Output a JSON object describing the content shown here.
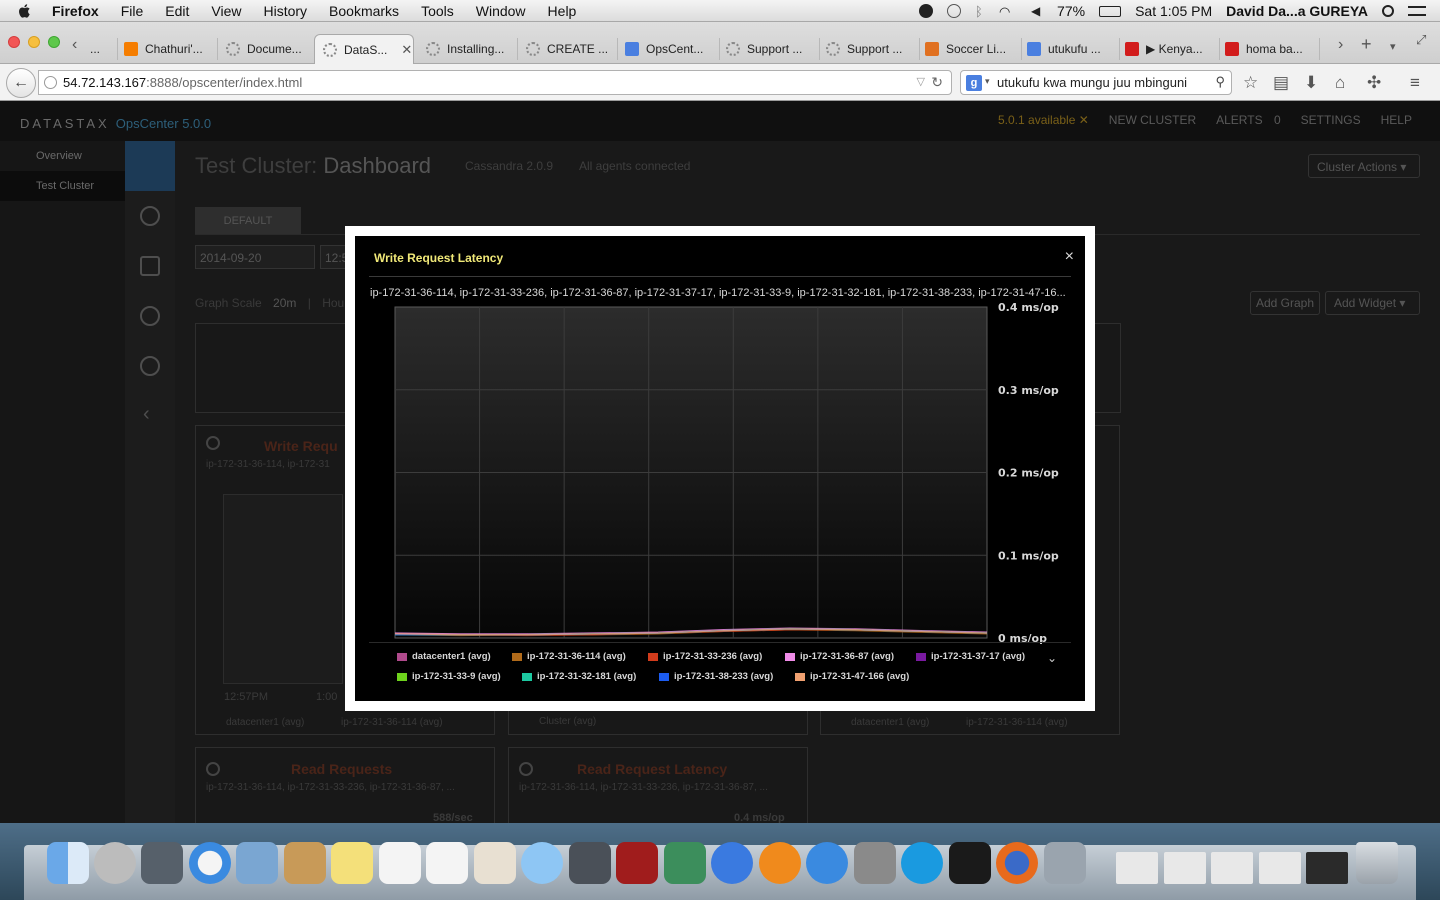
{
  "menubar": {
    "app": "Firefox",
    "items": [
      "File",
      "Edit",
      "View",
      "History",
      "Bookmarks",
      "Tools",
      "Window",
      "Help"
    ],
    "battery": "77%",
    "clock": "Sat 1:05 PM",
    "user": "David Da...a GUREYA"
  },
  "browser": {
    "tabs": [
      {
        "label": "...",
        "color": "#d0d0d0"
      },
      {
        "label": "Chathuri'...",
        "color": "#f57d00"
      },
      {
        "label": "Docume...",
        "color": "#888888"
      },
      {
        "label": "DataS...",
        "color": "#888888",
        "active": true
      },
      {
        "label": "Installing...",
        "color": "#888888"
      },
      {
        "label": "CREATE ...",
        "color": "#888888"
      },
      {
        "label": "OpsCent...",
        "color": "#4a7fe0"
      },
      {
        "label": "Support ...",
        "color": "#888888"
      },
      {
        "label": "Support ...",
        "color": "#888888"
      },
      {
        "label": "Soccer Li...",
        "color": "#e07020"
      },
      {
        "label": "utukufu ...",
        "color": "#4a7fe0"
      },
      {
        "label": "▶ Kenya...",
        "color": "#d21c1c"
      },
      {
        "label": "homa ba...",
        "color": "#d21c1c"
      }
    ],
    "url_host": "54.72.143.167",
    "url_rest": ":8888/opscenter/index.html",
    "search_value": "utukufu kwa mungu juu mbinguni"
  },
  "opscenter": {
    "logo": "DATASTAX",
    "version": "OpsCenter 5.0.0",
    "available": "5.0.1 available",
    "new_cluster": "NEW CLUSTER",
    "alerts": "ALERTS",
    "alerts_count": "0",
    "settings": "SETTINGS",
    "help": "HELP",
    "sidebar": [
      "Overview",
      "Test Cluster"
    ],
    "cluster_name": "Test Cluster:",
    "page_title": "Dashboard",
    "cassandra_version": "Cassandra 2.0.9",
    "agents": "All agents connected",
    "cluster_actions": "Cluster Actions",
    "tab_default": "DEFAULT",
    "date": "2014-09-20",
    "time_partial": "12:5",
    "graph_scale_label": "Graph Scale",
    "graph_scale_value": "20m",
    "graph_scale_hour": "Hou",
    "add_graph": "Add Graph",
    "add_widget": "Add Widget",
    "bg_widgets": {
      "write_requests_title": "Write Requ",
      "write_requests_hosts": "ip-172-31-36-114, ip-172-31",
      "read_requests_title": "Read Requests",
      "read_requests_hosts": "ip-172-31-36-114, ip-172-31-33-236, ip-172-31-36-87, ...",
      "read_requests_value": "588/sec",
      "read_latency_title": "Read Request Latency",
      "read_latency_hosts": "ip-172-31-36-114, ip-172-31-33-236, ip-172-31-36-87, ...",
      "read_latency_value": "0.4 ms/op",
      "time1": "12:57PM",
      "time2": "1:00",
      "legend_dc": "datacenter1 (avg)",
      "legend_host": "ip-172-31-36-114 (avg)",
      "legend_cluster": "Cluster (avg)"
    }
  },
  "modal": {
    "title": "Write Request Latency",
    "hosts": "ip-172-31-36-114, ip-172-31-33-236, ip-172-31-36-87, ip-172-31-37-17, ip-172-31-33-9, ip-172-31-32-181, ip-172-31-38-233, ip-172-31-47-16...",
    "close": "×",
    "expand": "⌄"
  },
  "chart_data": {
    "type": "line",
    "title": "Write Request Latency",
    "ylabel": "",
    "ylim": [
      0,
      0.4
    ],
    "yticks": [
      {
        "value": 0.4,
        "label": "0.4 ms/op"
      },
      {
        "value": 0.3,
        "label": "0.3 ms/op"
      },
      {
        "value": 0.2,
        "label": "0.2 ms/op"
      },
      {
        "value": 0.1,
        "label": "0.1 ms/op"
      },
      {
        "value": 0,
        "label": "0 ms/op"
      }
    ],
    "x_gridlines": 7,
    "grid": true,
    "legend_position": "bottom",
    "series": [
      {
        "name": "datacenter1 (avg)",
        "color": "#b04a8c",
        "values": [
          0.005,
          0.004,
          0.004,
          0.005,
          0.006,
          0.009,
          0.011,
          0.01,
          0.008,
          0.006
        ]
      },
      {
        "name": "ip-172-31-36-114 (avg)",
        "color": "#b06a1a",
        "values": [
          0.004,
          0.003,
          0.004,
          0.004,
          0.005,
          0.008,
          0.01,
          0.009,
          0.007,
          0.005
        ]
      },
      {
        "name": "ip-172-31-33-236 (avg)",
        "color": "#d23c1c",
        "values": [
          0.004,
          0.004,
          0.003,
          0.004,
          0.006,
          0.008,
          0.01,
          0.01,
          0.008,
          0.006
        ]
      },
      {
        "name": "ip-172-31-36-87 (avg)",
        "color": "#f08ce8",
        "values": [
          0.006,
          0.005,
          0.005,
          0.006,
          0.007,
          0.01,
          0.012,
          0.011,
          0.009,
          0.007
        ]
      },
      {
        "name": "ip-172-31-37-17 (avg)",
        "color": "#7a1aa0",
        "values": [
          0.004,
          0.004,
          0.004,
          0.005,
          0.006,
          0.009,
          0.011,
          0.01,
          0.008,
          0.006
        ]
      },
      {
        "name": "ip-172-31-33-9 (avg)",
        "color": "#6ed21c",
        "values": [
          0.004,
          0.004,
          0.004,
          0.005,
          0.006,
          0.009,
          0.011,
          0.01,
          0.008,
          0.006
        ]
      },
      {
        "name": "ip-172-31-32-181 (avg)",
        "color": "#1cc8a0",
        "values": [
          0.004,
          0.004,
          0.004,
          0.005,
          0.006,
          0.009,
          0.011,
          0.01,
          0.008,
          0.006
        ]
      },
      {
        "name": "ip-172-31-38-233 (avg)",
        "color": "#1c5cf0",
        "values": [
          0.004,
          0.004,
          0.004,
          0.005,
          0.006,
          0.009,
          0.011,
          0.01,
          0.008,
          0.006
        ]
      },
      {
        "name": "ip-172-31-47-166 (avg)",
        "color": "#f0a070",
        "values": [
          0.005,
          0.004,
          0.004,
          0.005,
          0.006,
          0.009,
          0.011,
          0.01,
          0.008,
          0.006
        ]
      }
    ]
  }
}
